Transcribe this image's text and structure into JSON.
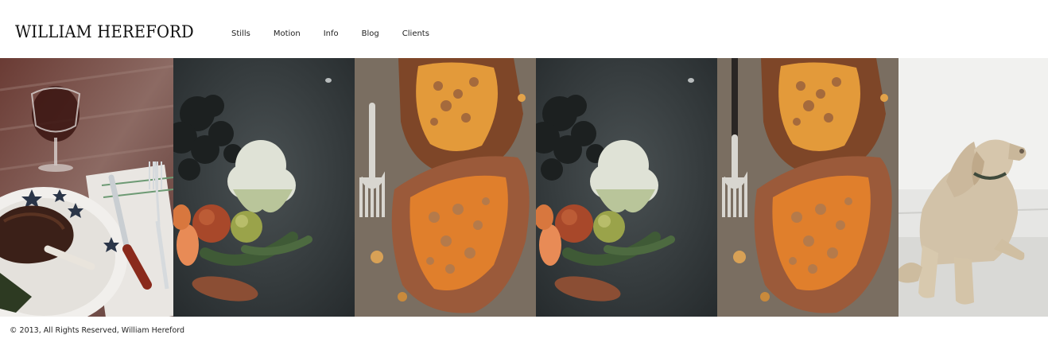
{
  "header": {
    "logo": "WILLIAM HEREFORD",
    "nav": [
      {
        "label": "Stills"
      },
      {
        "label": "Motion"
      },
      {
        "label": "Info"
      },
      {
        "label": "Blog"
      },
      {
        "label": "Clients"
      }
    ]
  },
  "gallery": {
    "photos": [
      {
        "subject": "steak dinner with wine glass, fork and knife"
      },
      {
        "subject": "cauliflower, kale and root vegetables on slate"
      },
      {
        "subject": "baked sweet potatoes with fork"
      },
      {
        "subject": "cauliflower, kale and root vegetables on slate"
      },
      {
        "subject": "baked sweet potatoes with fork"
      },
      {
        "subject": "weimaraner dog lying on concrete"
      }
    ]
  },
  "footer": {
    "copyright": "© 2013, All Rights Reserved, William Hereford"
  }
}
